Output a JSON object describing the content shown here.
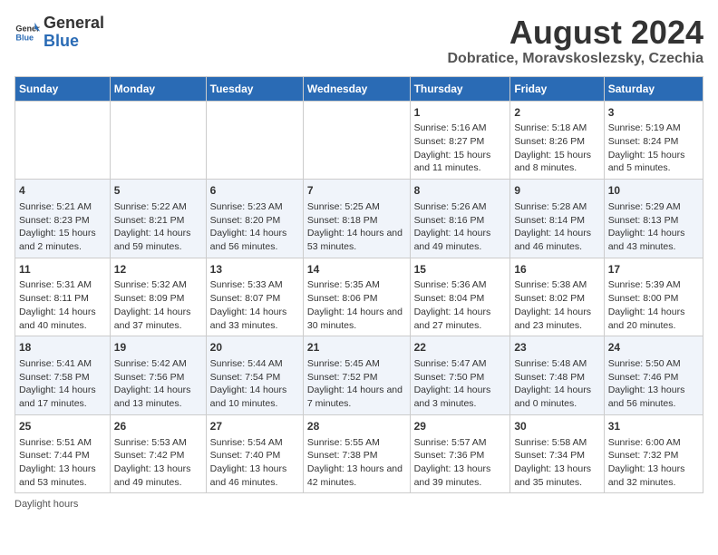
{
  "header": {
    "logo_general": "General",
    "logo_blue": "Blue",
    "title": "August 2024",
    "subtitle": "Dobratice, Moravskoslezsky, Czechia"
  },
  "calendar": {
    "days_of_week": [
      "Sunday",
      "Monday",
      "Tuesday",
      "Wednesday",
      "Thursday",
      "Friday",
      "Saturday"
    ],
    "weeks": [
      [
        {
          "day": "",
          "info": ""
        },
        {
          "day": "",
          "info": ""
        },
        {
          "day": "",
          "info": ""
        },
        {
          "day": "",
          "info": ""
        },
        {
          "day": "1",
          "info": "Sunrise: 5:16 AM\nSunset: 8:27 PM\nDaylight: 15 hours and 11 minutes."
        },
        {
          "day": "2",
          "info": "Sunrise: 5:18 AM\nSunset: 8:26 PM\nDaylight: 15 hours and 8 minutes."
        },
        {
          "day": "3",
          "info": "Sunrise: 5:19 AM\nSunset: 8:24 PM\nDaylight: 15 hours and 5 minutes."
        }
      ],
      [
        {
          "day": "4",
          "info": "Sunrise: 5:21 AM\nSunset: 8:23 PM\nDaylight: 15 hours and 2 minutes."
        },
        {
          "day": "5",
          "info": "Sunrise: 5:22 AM\nSunset: 8:21 PM\nDaylight: 14 hours and 59 minutes."
        },
        {
          "day": "6",
          "info": "Sunrise: 5:23 AM\nSunset: 8:20 PM\nDaylight: 14 hours and 56 minutes."
        },
        {
          "day": "7",
          "info": "Sunrise: 5:25 AM\nSunset: 8:18 PM\nDaylight: 14 hours and 53 minutes."
        },
        {
          "day": "8",
          "info": "Sunrise: 5:26 AM\nSunset: 8:16 PM\nDaylight: 14 hours and 49 minutes."
        },
        {
          "day": "9",
          "info": "Sunrise: 5:28 AM\nSunset: 8:14 PM\nDaylight: 14 hours and 46 minutes."
        },
        {
          "day": "10",
          "info": "Sunrise: 5:29 AM\nSunset: 8:13 PM\nDaylight: 14 hours and 43 minutes."
        }
      ],
      [
        {
          "day": "11",
          "info": "Sunrise: 5:31 AM\nSunset: 8:11 PM\nDaylight: 14 hours and 40 minutes."
        },
        {
          "day": "12",
          "info": "Sunrise: 5:32 AM\nSunset: 8:09 PM\nDaylight: 14 hours and 37 minutes."
        },
        {
          "day": "13",
          "info": "Sunrise: 5:33 AM\nSunset: 8:07 PM\nDaylight: 14 hours and 33 minutes."
        },
        {
          "day": "14",
          "info": "Sunrise: 5:35 AM\nSunset: 8:06 PM\nDaylight: 14 hours and 30 minutes."
        },
        {
          "day": "15",
          "info": "Sunrise: 5:36 AM\nSunset: 8:04 PM\nDaylight: 14 hours and 27 minutes."
        },
        {
          "day": "16",
          "info": "Sunrise: 5:38 AM\nSunset: 8:02 PM\nDaylight: 14 hours and 23 minutes."
        },
        {
          "day": "17",
          "info": "Sunrise: 5:39 AM\nSunset: 8:00 PM\nDaylight: 14 hours and 20 minutes."
        }
      ],
      [
        {
          "day": "18",
          "info": "Sunrise: 5:41 AM\nSunset: 7:58 PM\nDaylight: 14 hours and 17 minutes."
        },
        {
          "day": "19",
          "info": "Sunrise: 5:42 AM\nSunset: 7:56 PM\nDaylight: 14 hours and 13 minutes."
        },
        {
          "day": "20",
          "info": "Sunrise: 5:44 AM\nSunset: 7:54 PM\nDaylight: 14 hours and 10 minutes."
        },
        {
          "day": "21",
          "info": "Sunrise: 5:45 AM\nSunset: 7:52 PM\nDaylight: 14 hours and 7 minutes."
        },
        {
          "day": "22",
          "info": "Sunrise: 5:47 AM\nSunset: 7:50 PM\nDaylight: 14 hours and 3 minutes."
        },
        {
          "day": "23",
          "info": "Sunrise: 5:48 AM\nSunset: 7:48 PM\nDaylight: 14 hours and 0 minutes."
        },
        {
          "day": "24",
          "info": "Sunrise: 5:50 AM\nSunset: 7:46 PM\nDaylight: 13 hours and 56 minutes."
        }
      ],
      [
        {
          "day": "25",
          "info": "Sunrise: 5:51 AM\nSunset: 7:44 PM\nDaylight: 13 hours and 53 minutes."
        },
        {
          "day": "26",
          "info": "Sunrise: 5:53 AM\nSunset: 7:42 PM\nDaylight: 13 hours and 49 minutes."
        },
        {
          "day": "27",
          "info": "Sunrise: 5:54 AM\nSunset: 7:40 PM\nDaylight: 13 hours and 46 minutes."
        },
        {
          "day": "28",
          "info": "Sunrise: 5:55 AM\nSunset: 7:38 PM\nDaylight: 13 hours and 42 minutes."
        },
        {
          "day": "29",
          "info": "Sunrise: 5:57 AM\nSunset: 7:36 PM\nDaylight: 13 hours and 39 minutes."
        },
        {
          "day": "30",
          "info": "Sunrise: 5:58 AM\nSunset: 7:34 PM\nDaylight: 13 hours and 35 minutes."
        },
        {
          "day": "31",
          "info": "Sunrise: 6:00 AM\nSunset: 7:32 PM\nDaylight: 13 hours and 32 minutes."
        }
      ]
    ]
  },
  "footer": {
    "note": "Daylight hours"
  }
}
